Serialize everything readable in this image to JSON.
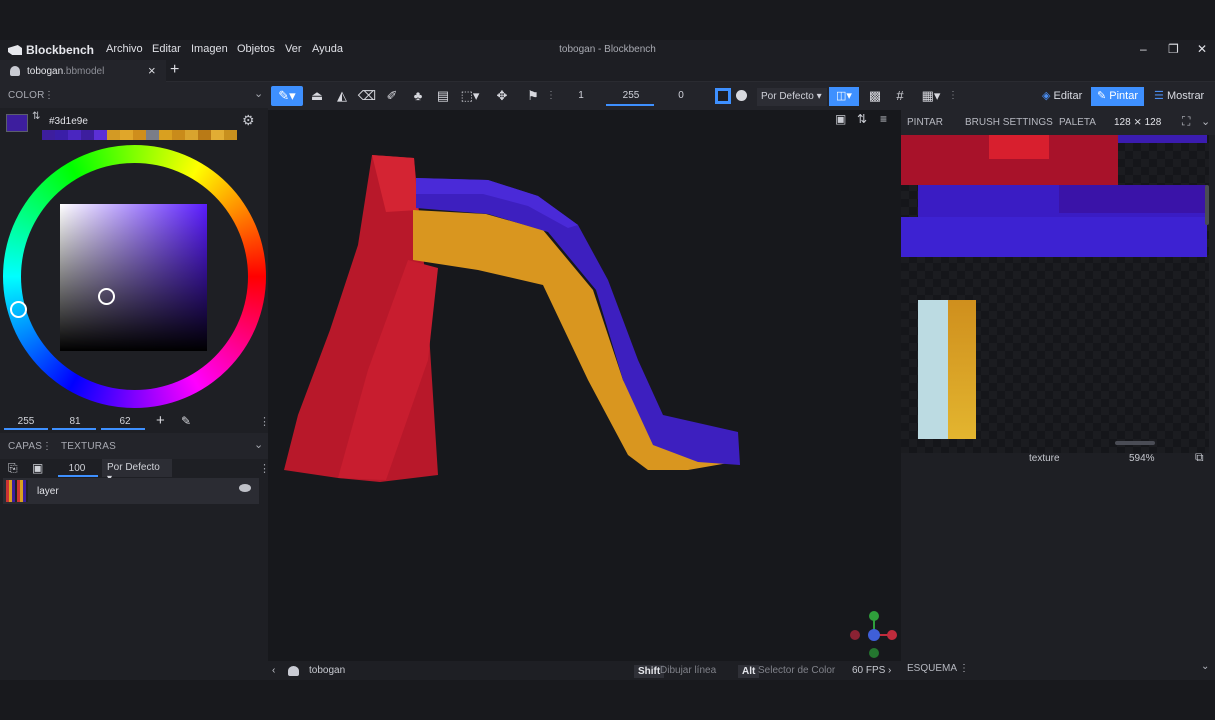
{
  "app": {
    "brand": "Blockbench",
    "window_title": "tobogan - Blockbench",
    "menu": [
      "Archivo",
      "Editar",
      "Imagen",
      "Objetos",
      "Ver",
      "Ayuda"
    ]
  },
  "tab": {
    "name": "tobogan",
    "ext": ".bbmodel",
    "close": "×",
    "add": "+"
  },
  "toolbar": {
    "brush_size": "1",
    "opacity": "255",
    "softness": "0",
    "blend_mode": "Por Defecto"
  },
  "modes": {
    "edit": "Editar",
    "paint": "Pintar",
    "display": "Mostrar"
  },
  "color_panel": {
    "title": "COLOR",
    "hex": "#3d1e9e",
    "current_color": "#3d1e9e",
    "palette": [
      "#3d1e9e",
      "#3a1ea8",
      "#4a26c0",
      "#3d1e9e",
      "#5b2fd6",
      "#d39a24",
      "#e0a62a",
      "#cf8e1c",
      "#7a7d88",
      "#d9a020",
      "#c98b1a",
      "#d9a42e",
      "#b97a16",
      "#e1ad34",
      "#c8901e"
    ],
    "r": "255",
    "g": "81",
    "b": "62"
  },
  "layers_panel": {
    "tab_layers": "CAPAS",
    "tab_textures": "TEXTURAS",
    "opacity": "100",
    "blend": "Por Defecto",
    "layer_name": "layer"
  },
  "right_panel": {
    "tabs": [
      "PINTAR",
      "BRUSH SETTINGS",
      "PALETA"
    ],
    "resolution": "128 ⨯ 128",
    "texture_name": "texture",
    "zoom": "594%",
    "outline": "ESQUEMA"
  },
  "statusbar": {
    "model": "tobogan",
    "shift_key": "Shift",
    "shift_action": "Dibujar línea",
    "alt_key": "Alt",
    "alt_action": "Selector de Color",
    "fps": "60 FPS"
  }
}
